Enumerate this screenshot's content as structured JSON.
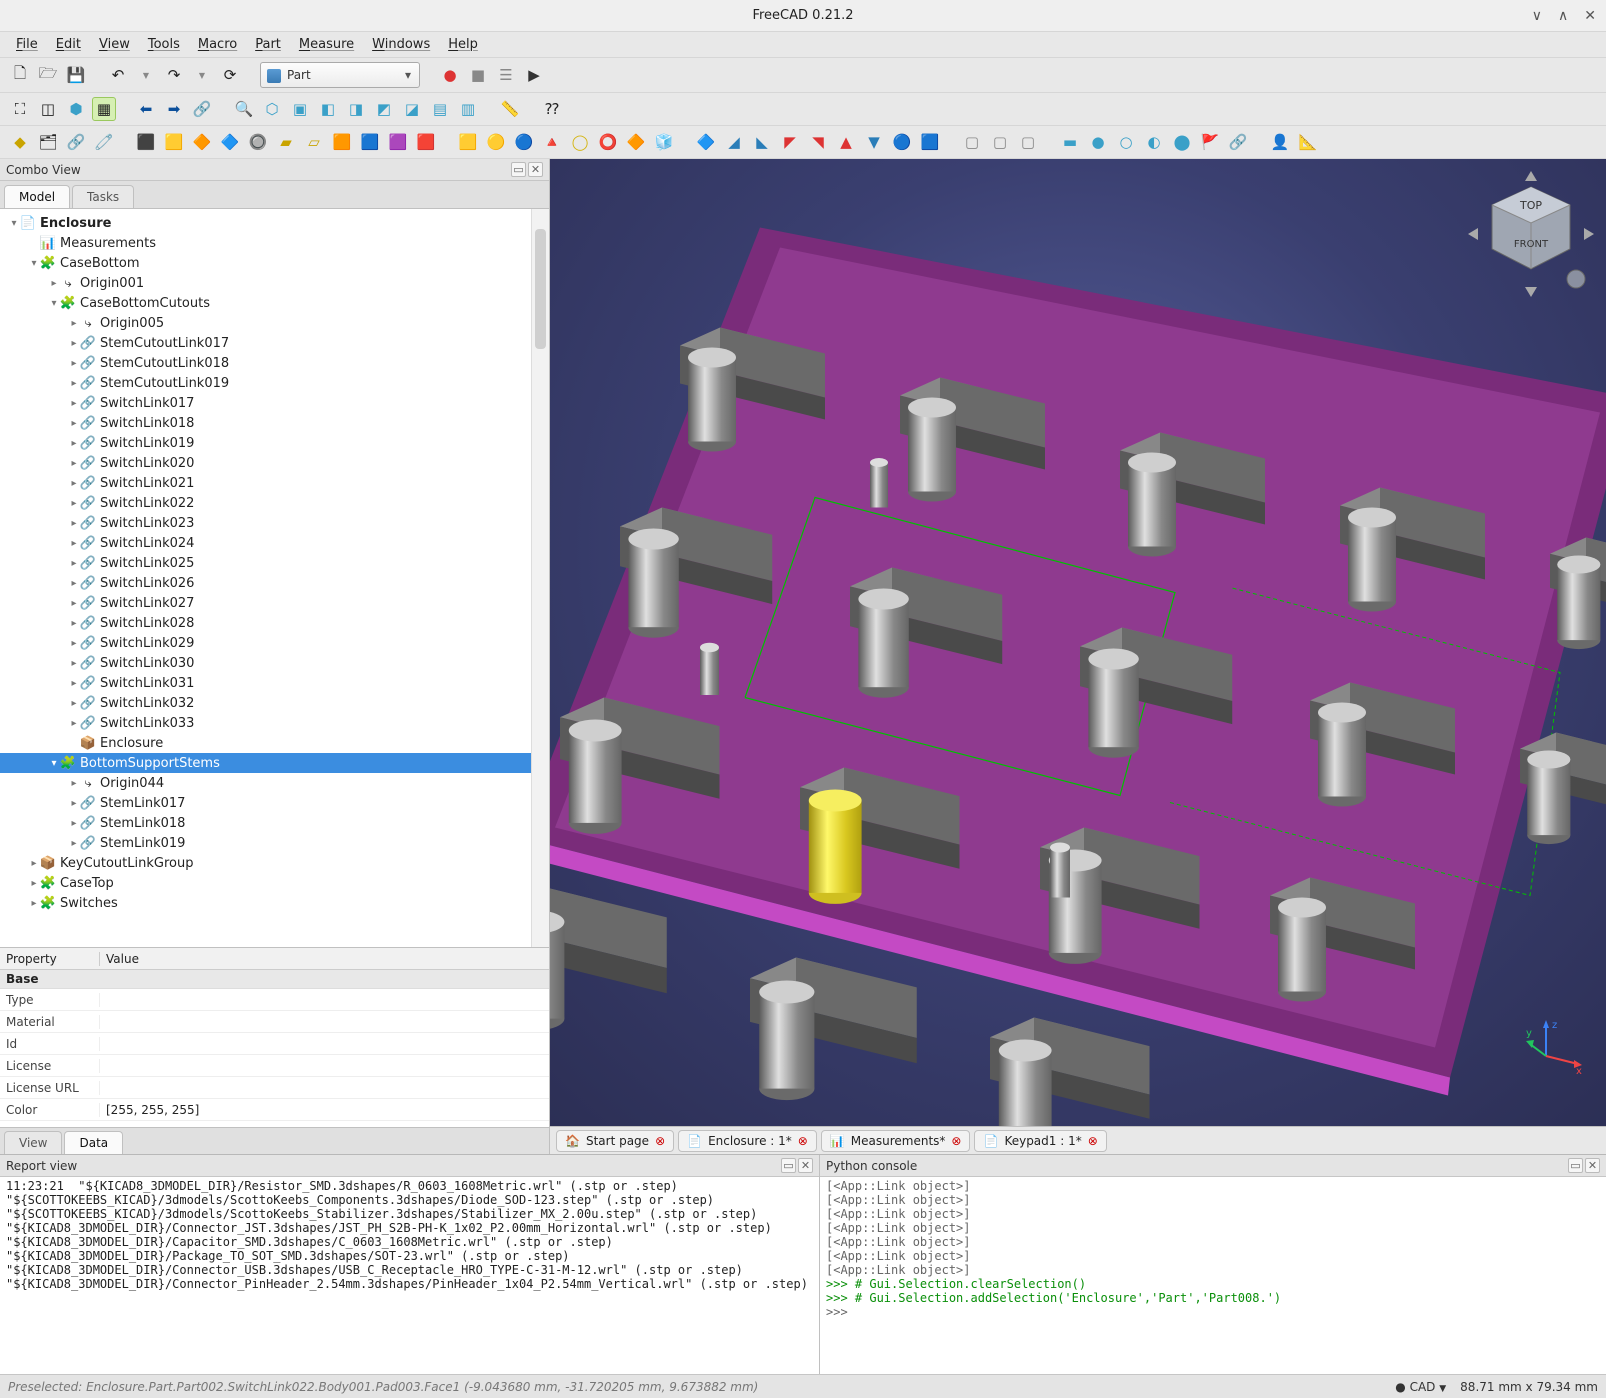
{
  "title": "FreeCAD 0.21.2",
  "menubar": [
    "File",
    "Edit",
    "View",
    "Tools",
    "Macro",
    "Part",
    "Measure",
    "Windows",
    "Help"
  ],
  "workbench": "Part",
  "combo": {
    "title": "Combo View",
    "tabs": [
      "Model",
      "Tasks"
    ],
    "active_tab": "Model"
  },
  "tree": [
    {
      "d": 0,
      "exp": "▾",
      "icon": "📄",
      "label": "Enclosure",
      "bold": true
    },
    {
      "d": 1,
      "exp": " ",
      "icon": "📊",
      "label": "Measurements"
    },
    {
      "d": 1,
      "exp": "▾",
      "icon": "🧩",
      "label": "CaseBottom",
      "color": "#c9a400"
    },
    {
      "d": 2,
      "exp": "▸",
      "icon": "↳",
      "label": "Origin001"
    },
    {
      "d": 2,
      "exp": "▾",
      "icon": "🧩",
      "label": "CaseBottomCutouts",
      "color": "#c9a400"
    },
    {
      "d": 3,
      "exp": "▸",
      "icon": "↳",
      "label": "Origin005"
    },
    {
      "d": 3,
      "exp": "▸",
      "icon": "🔗",
      "label": "StemCutoutLink017"
    },
    {
      "d": 3,
      "exp": "▸",
      "icon": "🔗",
      "label": "StemCutoutLink018"
    },
    {
      "d": 3,
      "exp": "▸",
      "icon": "🔗",
      "label": "StemCutoutLink019"
    },
    {
      "d": 3,
      "exp": "▸",
      "icon": "🔗",
      "label": "SwitchLink017"
    },
    {
      "d": 3,
      "exp": "▸",
      "icon": "🔗",
      "label": "SwitchLink018"
    },
    {
      "d": 3,
      "exp": "▸",
      "icon": "🔗",
      "label": "SwitchLink019"
    },
    {
      "d": 3,
      "exp": "▸",
      "icon": "🔗",
      "label": "SwitchLink020"
    },
    {
      "d": 3,
      "exp": "▸",
      "icon": "🔗",
      "label": "SwitchLink021"
    },
    {
      "d": 3,
      "exp": "▸",
      "icon": "🔗",
      "label": "SwitchLink022"
    },
    {
      "d": 3,
      "exp": "▸",
      "icon": "🔗",
      "label": "SwitchLink023"
    },
    {
      "d": 3,
      "exp": "▸",
      "icon": "🔗",
      "label": "SwitchLink024"
    },
    {
      "d": 3,
      "exp": "▸",
      "icon": "🔗",
      "label": "SwitchLink025"
    },
    {
      "d": 3,
      "exp": "▸",
      "icon": "🔗",
      "label": "SwitchLink026"
    },
    {
      "d": 3,
      "exp": "▸",
      "icon": "🔗",
      "label": "SwitchLink027"
    },
    {
      "d": 3,
      "exp": "▸",
      "icon": "🔗",
      "label": "SwitchLink028"
    },
    {
      "d": 3,
      "exp": "▸",
      "icon": "🔗",
      "label": "SwitchLink029"
    },
    {
      "d": 3,
      "exp": "▸",
      "icon": "🔗",
      "label": "SwitchLink030"
    },
    {
      "d": 3,
      "exp": "▸",
      "icon": "🔗",
      "label": "SwitchLink031"
    },
    {
      "d": 3,
      "exp": "▸",
      "icon": "🔗",
      "label": "SwitchLink032"
    },
    {
      "d": 3,
      "exp": "▸",
      "icon": "🔗",
      "label": "SwitchLink033"
    },
    {
      "d": 3,
      "exp": " ",
      "icon": "📦",
      "label": "Enclosure"
    },
    {
      "d": 2,
      "exp": "▾",
      "icon": "🧩",
      "label": "BottomSupportStems",
      "color": "#c9a400",
      "selected": true
    },
    {
      "d": 3,
      "exp": "▸",
      "icon": "↳",
      "label": "Origin044"
    },
    {
      "d": 3,
      "exp": "▸",
      "icon": "🔗",
      "label": "StemLink017"
    },
    {
      "d": 3,
      "exp": "▸",
      "icon": "🔗",
      "label": "StemLink018"
    },
    {
      "d": 3,
      "exp": "▸",
      "icon": "🔗",
      "label": "StemLink019"
    },
    {
      "d": 1,
      "exp": "▸",
      "icon": "📦",
      "label": "KeyCutoutLinkGroup"
    },
    {
      "d": 1,
      "exp": "▸",
      "icon": "🧩",
      "label": "CaseTop",
      "color": "#c9a400"
    },
    {
      "d": 1,
      "exp": "▸",
      "icon": "🧩",
      "label": "Switches",
      "color": "#c9a400"
    }
  ],
  "properties": {
    "header": {
      "prop": "Property",
      "val": "Value"
    },
    "section": "Base",
    "rows": [
      {
        "k": "Type",
        "v": ""
      },
      {
        "k": "Material",
        "v": ""
      },
      {
        "k": "Id",
        "v": ""
      },
      {
        "k": "License",
        "v": ""
      },
      {
        "k": "License URL",
        "v": ""
      },
      {
        "k": "Color",
        "v": "[255, 255, 255]"
      }
    ],
    "tabs": [
      "View",
      "Data"
    ],
    "active": "Data"
  },
  "doc_tabs": [
    {
      "icon": "🏠",
      "label": "Start page",
      "close": true
    },
    {
      "icon": "📄",
      "label": "Enclosure : 1*",
      "close": true
    },
    {
      "icon": "📊",
      "label": "Measurements*",
      "close": true
    },
    {
      "icon": "📄",
      "label": "Keypad1 : 1*",
      "close": true
    }
  ],
  "report": {
    "title": "Report view",
    "lines": [
      "11:23:21  \"${KICAD8_3DMODEL_DIR}/Resistor_SMD.3dshapes/R_0603_1608Metric.wrl\" (.stp or .step)",
      "\"${SCOTTOKEEBS_KICAD}/3dmodels/ScottoKeebs_Components.3dshapes/Diode_SOD-123.step\" (.stp or .step)",
      "\"${SCOTTOKEEBS_KICAD}/3dmodels/ScottoKeebs_Stabilizer.3dshapes/Stabilizer_MX_2.00u.step\" (.stp or .step)",
      "\"${KICAD8_3DMODEL_DIR}/Connector_JST.3dshapes/JST_PH_S2B-PH-K_1x02_P2.00mm_Horizontal.wrl\" (.stp or .step)",
      "\"${KICAD8_3DMODEL_DIR}/Capacitor_SMD.3dshapes/C_0603_1608Metric.wrl\" (.stp or .step)",
      "\"${KICAD8_3DMODEL_DIR}/Package_TO_SOT_SMD.3dshapes/SOT-23.wrl\" (.stp or .step)",
      "\"${KICAD8_3DMODEL_DIR}/Connector_USB.3dshapes/USB_C_Receptacle_HRO_TYPE-C-31-M-12.wrl\" (.stp or .step)",
      "\"${KICAD8_3DMODEL_DIR}/Connector_PinHeader_2.54mm.3dshapes/PinHeader_1x04_P2.54mm_Vertical.wrl\" (.stp or .step)"
    ]
  },
  "pycon": {
    "title": "Python console",
    "lines": [
      {
        "t": "code",
        "text": "[<App::Link object>]"
      },
      {
        "t": "code",
        "text": "[<App::Link object>]"
      },
      {
        "t": "code",
        "text": "[<App::Link object>]"
      },
      {
        "t": "code",
        "text": "[<App::Link object>]"
      },
      {
        "t": "code",
        "text": "[<App::Link object>]"
      },
      {
        "t": "code",
        "text": "[<App::Link object>]"
      },
      {
        "t": "code",
        "text": "[<App::Link object>]"
      },
      {
        "t": "comment",
        "text": ">>> # Gui.Selection.clearSelection()"
      },
      {
        "t": "comment",
        "text": ">>> # Gui.Selection.addSelection('Enclosure','Part','Part008.')"
      },
      {
        "t": "code",
        "text": ">>> "
      }
    ]
  },
  "statusbar": {
    "left": "Preselected: Enclosure.Part.Part002.SwitchLink022.Body001.Pad003.Face1 (-9.043680 mm, -31.720205 mm, 9.673882 mm)",
    "mode": "CAD",
    "dims": "88.71 mm x 79.34 mm"
  },
  "navcube": {
    "top": "TOP",
    "front": "FRONT"
  }
}
